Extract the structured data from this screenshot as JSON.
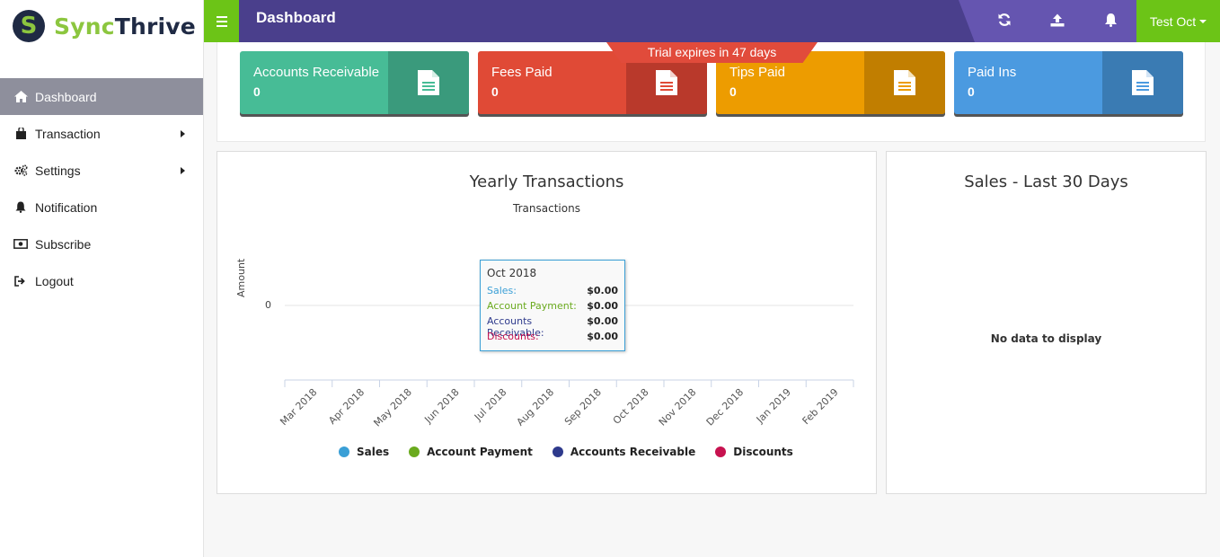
{
  "brand": {
    "part1": "Sync",
    "part2": "Thrive",
    "logo_letter": "S"
  },
  "sidebar": {
    "items": [
      {
        "label": "Dashboard",
        "icon": "home-icon",
        "active": true
      },
      {
        "label": "Transaction",
        "icon": "shopping-bag-icon",
        "submenu": true
      },
      {
        "label": "Settings",
        "icon": "gears-icon",
        "submenu": true
      },
      {
        "label": "Notification",
        "icon": "bell-icon"
      },
      {
        "label": "Subscribe",
        "icon": "money-icon"
      },
      {
        "label": "Logout",
        "icon": "sign-out-icon"
      }
    ]
  },
  "header": {
    "title": "Dashboard",
    "user": "Test Oct",
    "icons": [
      "refresh-icon",
      "upload-icon",
      "bell-icon"
    ]
  },
  "trial_banner": "Trial expires in 47 days",
  "stats": [
    {
      "label": "Accounts Receivable",
      "value": "0",
      "color": "#47bc96",
      "icon_bg": "#3a9a7c"
    },
    {
      "label": "Fees Paid",
      "value": "0",
      "color": "#e04a36",
      "icon_bg": "#b9392b"
    },
    {
      "label": "Tips Paid",
      "value": "0",
      "color": "#ed9c00",
      "icon_bg": "#c17e00"
    },
    {
      "label": "Paid Ins",
      "value": "0",
      "color": "#4b9ae0",
      "icon_bg": "#3a7bb3"
    }
  ],
  "chart_data": {
    "type": "line",
    "title": "Yearly Transactions",
    "subtitle": "Transactions",
    "ylabel": "Amount",
    "xlabel": "",
    "categories": [
      "Mar 2018",
      "Apr 2018",
      "May 2018",
      "Jun 2018",
      "Jul 2018",
      "Aug 2018",
      "Sep 2018",
      "Oct 2018",
      "Nov 2018",
      "Dec 2018",
      "Jan 2019",
      "Feb 2019"
    ],
    "y_ticks": [
      "0"
    ],
    "series": [
      {
        "name": "Sales",
        "color": "#3a9fd6",
        "values": [
          0,
          0,
          0,
          0,
          0,
          0,
          0,
          0,
          0,
          0,
          0,
          0
        ]
      },
      {
        "name": "Account Payment",
        "color": "#6aaa1e",
        "values": [
          0,
          0,
          0,
          0,
          0,
          0,
          0,
          0,
          0,
          0,
          0,
          0
        ]
      },
      {
        "name": "Accounts Receivable",
        "color": "#2e3a8c",
        "values": [
          0,
          0,
          0,
          0,
          0,
          0,
          0,
          0,
          0,
          0,
          0,
          0
        ]
      },
      {
        "name": "Discounts",
        "color": "#c7124f",
        "values": [
          0,
          0,
          0,
          0,
          0,
          0,
          0,
          0,
          0,
          0,
          0,
          0
        ]
      }
    ],
    "legend": "bottom",
    "tooltip": {
      "title": "Oct 2018",
      "rows": [
        {
          "label": "Sales:",
          "value": "$0.00",
          "color": "#3a9fd6"
        },
        {
          "label": "Account Payment:",
          "value": "$0.00",
          "color": "#6aaa1e"
        },
        {
          "label": "Accounts Receivable:",
          "value": "$0.00",
          "color": "#2e3a8c"
        },
        {
          "label": "Discounts:",
          "value": "$0.00",
          "color": "#c7124f"
        }
      ]
    }
  },
  "sales_panel": {
    "title": "Sales - Last 30 Days",
    "empty": "No data to display"
  }
}
